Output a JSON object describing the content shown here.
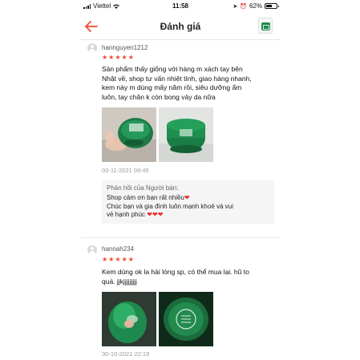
{
  "status_bar": {
    "carrier": "Viettel",
    "time": "11:58",
    "battery_percent": "62%",
    "battery_level": 0.62
  },
  "header": {
    "title": "Đánh giá"
  },
  "reviews": [
    {
      "username": "hannguyen1212",
      "rating": 5,
      "text_lines": [
        "Sản phẩm thấy giống với hàng m xách tay bên",
        "Nhật về, shop tư vấn nhiệt tình, giao hàng nhanh,",
        "kem này m dùng mấy năm rồi, siêu dưỡng ẩm",
        "luôn, tay chân k còn bong vảy da nữa"
      ],
      "date": "03-11-2021 09:45",
      "seller_reply": {
        "title": "Phản hồi của Người bán:",
        "lines": [
          "Shop cảm ơn bạn rất nhiều",
          "Chúc bạn và gia đình luôn mạnh khoẻ và vui",
          "vẻ hạnh phúc"
        ]
      }
    },
    {
      "username": "hannah234",
      "rating": 5,
      "text_lines": [
        "Kem dùng ok la hài lòng sp, có thể mua lại. hũ to",
        "quá. jjkjjjjjjjjj"
      ],
      "date": "30-10-2021 22:19"
    }
  ],
  "colors": {
    "accent": "#ee4d2d",
    "heart": "#e5322d",
    "jar_green": "#1f8a4c"
  }
}
